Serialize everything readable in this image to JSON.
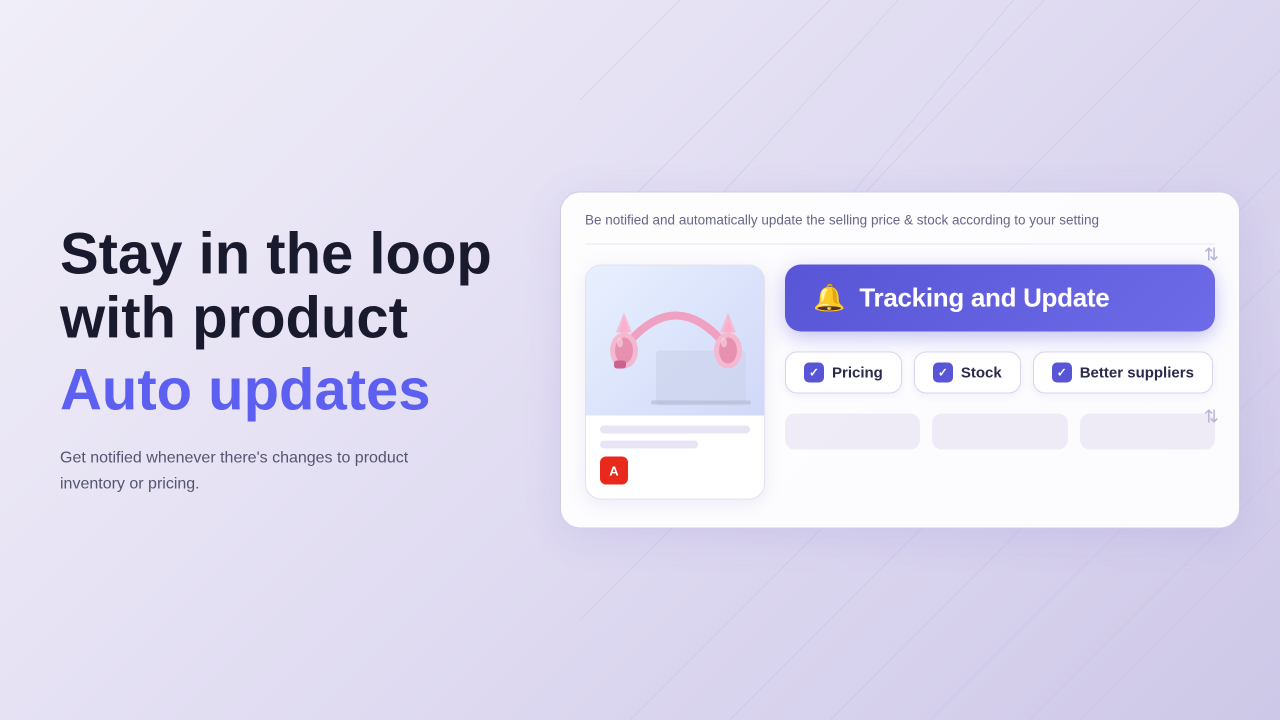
{
  "background": {
    "gradient_start": "#f0eef8",
    "gradient_end": "#cec8e8"
  },
  "left": {
    "headline_line1": "Stay in the loop",
    "headline_line2": "with product",
    "headline_accent": "Auto updates",
    "subtext": "Get notified whenever there's changes to product inventory or pricing."
  },
  "right": {
    "card_description": "Be notified and automatically update the selling price & stock according to your setting",
    "tracking_button_label": "Tracking and Update",
    "tracking_button_icon": "🔔",
    "tags": [
      {
        "label": "Pricing",
        "checked": true
      },
      {
        "label": "Stock",
        "checked": true
      },
      {
        "label": "Better suppliers",
        "checked": true
      }
    ],
    "product_icon": "A",
    "colors": {
      "button_bg": "#5855d6",
      "accent": "#5c5fef"
    }
  }
}
